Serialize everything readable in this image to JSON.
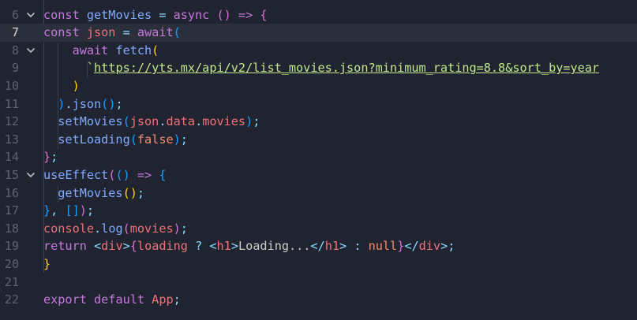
{
  "editor": {
    "lines": [
      {
        "num": "6",
        "fold": true,
        "segs": [
          {
            "t": "const ",
            "c": "k"
          },
          {
            "t": "getMovies",
            "c": "f"
          },
          {
            "t": " = ",
            "c": "p"
          },
          {
            "t": "async",
            "c": "k"
          },
          {
            "t": " ",
            "c": "t"
          },
          {
            "t": "()",
            "c": "b2"
          },
          {
            "t": " => ",
            "c": "k"
          },
          {
            "t": "{",
            "c": "b2"
          }
        ]
      },
      {
        "num": "7",
        "active": true,
        "segs": [
          {
            "t": "const ",
            "c": "k"
          },
          {
            "t": "json",
            "c": "v"
          },
          {
            "t": " = ",
            "c": "p"
          },
          {
            "t": "await",
            "c": "k"
          },
          {
            "t": "(",
            "c": "b3"
          }
        ]
      },
      {
        "num": "8",
        "fold": true,
        "segs": [
          {
            "t": "    await ",
            "c": "k"
          },
          {
            "t": "fetch",
            "c": "f"
          },
          {
            "t": "(",
            "c": "b1"
          }
        ]
      },
      {
        "num": "9",
        "segs": [
          {
            "t": "      `",
            "c": "s"
          },
          {
            "t": "https://yts.mx/api/v2/list_movies.json?minimum_rating=8.8&sort_by=year",
            "c": "u"
          }
        ]
      },
      {
        "num": "10",
        "segs": [
          {
            "t": "    )",
            "c": "b1"
          }
        ]
      },
      {
        "num": "11",
        "segs": [
          {
            "t": "  )",
            "c": "b3"
          },
          {
            "t": ".",
            "c": "p"
          },
          {
            "t": "json",
            "c": "f"
          },
          {
            "t": "()",
            "c": "b3"
          },
          {
            "t": ";",
            "c": "p"
          }
        ]
      },
      {
        "num": "12",
        "segs": [
          {
            "t": "  setMovies",
            "c": "f"
          },
          {
            "t": "(",
            "c": "b3"
          },
          {
            "t": "json",
            "c": "v"
          },
          {
            "t": ".",
            "c": "p"
          },
          {
            "t": "data",
            "c": "v"
          },
          {
            "t": ".",
            "c": "p"
          },
          {
            "t": "movies",
            "c": "v"
          },
          {
            "t": ")",
            "c": "b3"
          },
          {
            "t": ";",
            "c": "p"
          }
        ]
      },
      {
        "num": "13",
        "segs": [
          {
            "t": "  setLoading",
            "c": "f"
          },
          {
            "t": "(",
            "c": "b3"
          },
          {
            "t": "false",
            "c": "c"
          },
          {
            "t": ")",
            "c": "b3"
          },
          {
            "t": ";",
            "c": "p"
          }
        ]
      },
      {
        "num": "14",
        "segs": [
          {
            "t": "}",
            "c": "b2"
          },
          {
            "t": ";",
            "c": "p"
          }
        ]
      },
      {
        "num": "15",
        "fold": true,
        "segs": [
          {
            "t": "useEffect",
            "c": "f"
          },
          {
            "t": "(",
            "c": "b2"
          },
          {
            "t": "()",
            "c": "b3"
          },
          {
            "t": " => ",
            "c": "k"
          },
          {
            "t": "{",
            "c": "b3"
          }
        ]
      },
      {
        "num": "16",
        "segs": [
          {
            "t": "  getMovies",
            "c": "f"
          },
          {
            "t": "()",
            "c": "b1"
          },
          {
            "t": ";",
            "c": "p"
          }
        ]
      },
      {
        "num": "17",
        "segs": [
          {
            "t": "}",
            "c": "b3"
          },
          {
            "t": ", ",
            "c": "p"
          },
          {
            "t": "[]",
            "c": "b3"
          },
          {
            "t": ")",
            "c": "b2"
          },
          {
            "t": ";",
            "c": "p"
          }
        ]
      },
      {
        "num": "18",
        "segs": [
          {
            "t": "console",
            "c": "v"
          },
          {
            "t": ".",
            "c": "p"
          },
          {
            "t": "log",
            "c": "f"
          },
          {
            "t": "(",
            "c": "b2"
          },
          {
            "t": "movies",
            "c": "v"
          },
          {
            "t": ")",
            "c": "b2"
          },
          {
            "t": ";",
            "c": "p"
          }
        ]
      },
      {
        "num": "19",
        "segs": [
          {
            "t": "return ",
            "c": "k"
          },
          {
            "t": "<",
            "c": "p"
          },
          {
            "t": "div",
            "c": "tag"
          },
          {
            "t": ">",
            "c": "p"
          },
          {
            "t": "{",
            "c": "b2"
          },
          {
            "t": "loading",
            "c": "v"
          },
          {
            "t": " ? ",
            "c": "p"
          },
          {
            "t": "<",
            "c": "p"
          },
          {
            "t": "h1",
            "c": "tag"
          },
          {
            "t": ">",
            "c": "p"
          },
          {
            "t": "Loading...",
            "c": "t"
          },
          {
            "t": "</",
            "c": "p"
          },
          {
            "t": "h1",
            "c": "tag"
          },
          {
            "t": ">",
            "c": "p"
          },
          {
            "t": " : ",
            "c": "p"
          },
          {
            "t": "null",
            "c": "c"
          },
          {
            "t": "}",
            "c": "b2"
          },
          {
            "t": "</",
            "c": "p"
          },
          {
            "t": "div",
            "c": "tag"
          },
          {
            "t": ">",
            "c": "p"
          },
          {
            "t": ";",
            "c": "p"
          }
        ]
      },
      {
        "num": "20",
        "segs": [
          {
            "t": "}",
            "c": "b1"
          }
        ]
      },
      {
        "num": "21",
        "segs": []
      },
      {
        "num": "22",
        "segs": [
          {
            "t": "export ",
            "c": "k"
          },
          {
            "t": "default ",
            "c": "k"
          },
          {
            "t": "App",
            "c": "v"
          },
          {
            "t": ";",
            "c": "p"
          }
        ]
      }
    ]
  }
}
